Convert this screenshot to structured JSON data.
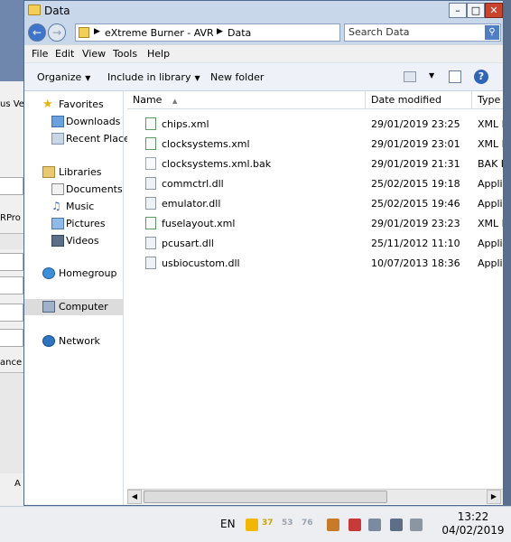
{
  "window": {
    "title": "Data",
    "controls": {
      "minimize": "–",
      "maximize": "□",
      "close": "✕"
    }
  },
  "address": {
    "crumbs": [
      "eXtreme Burner - AVR",
      "Data"
    ],
    "search_placeholder": "Search Data"
  },
  "menu": [
    "File",
    "Edit",
    "View",
    "Tools",
    "Help"
  ],
  "toolbar": {
    "organize": "Organize",
    "include_in_library": "Include in library",
    "new_folder": "New folder"
  },
  "nav": {
    "favorites": "Favorites",
    "downloads": "Downloads",
    "recent_places": "Recent Places",
    "libraries": "Libraries",
    "documents": "Documents",
    "music": "Music",
    "pictures": "Pictures",
    "videos": "Videos",
    "homegroup": "Homegroup",
    "computer": "Computer",
    "network": "Network"
  },
  "columns": {
    "name": "Name",
    "date_modified": "Date modified",
    "type": "Type"
  },
  "files": [
    {
      "name": "chips.xml",
      "date": "29/01/2019 23:25",
      "type": "XML D"
    },
    {
      "name": "clocksystems.xml",
      "date": "29/01/2019 23:01",
      "type": "XML D"
    },
    {
      "name": "clocksystems.xml.bak",
      "date": "29/01/2019 21:31",
      "type": "BAK F"
    },
    {
      "name": "commctrl.dll",
      "date": "25/02/2015 19:18",
      "type": "Applic"
    },
    {
      "name": "emulator.dll",
      "date": "25/02/2015 19:46",
      "type": "Applic"
    },
    {
      "name": "fuselayout.xml",
      "date": "29/01/2019 23:23",
      "type": "XML D"
    },
    {
      "name": "pcusart.dll",
      "date": "25/11/2012 11:10",
      "type": "Applic"
    },
    {
      "name": "usbiocustom.dll",
      "date": "10/07/2013 18:36",
      "type": "Applic"
    }
  ],
  "background_app": {
    "labels": [
      "us Ve",
      "RPro",
      "ance",
      "A"
    ]
  },
  "taskbar": {
    "language": "EN",
    "tray_numbers": [
      "37",
      "53",
      "76"
    ],
    "time": "13:22",
    "date": "04/02/2019"
  },
  "colors": {
    "window_frame": "#c9d7ea",
    "close_button": "#c8442f",
    "selected_nav": "#dcdcdc",
    "taskbar": "#eceef1"
  }
}
